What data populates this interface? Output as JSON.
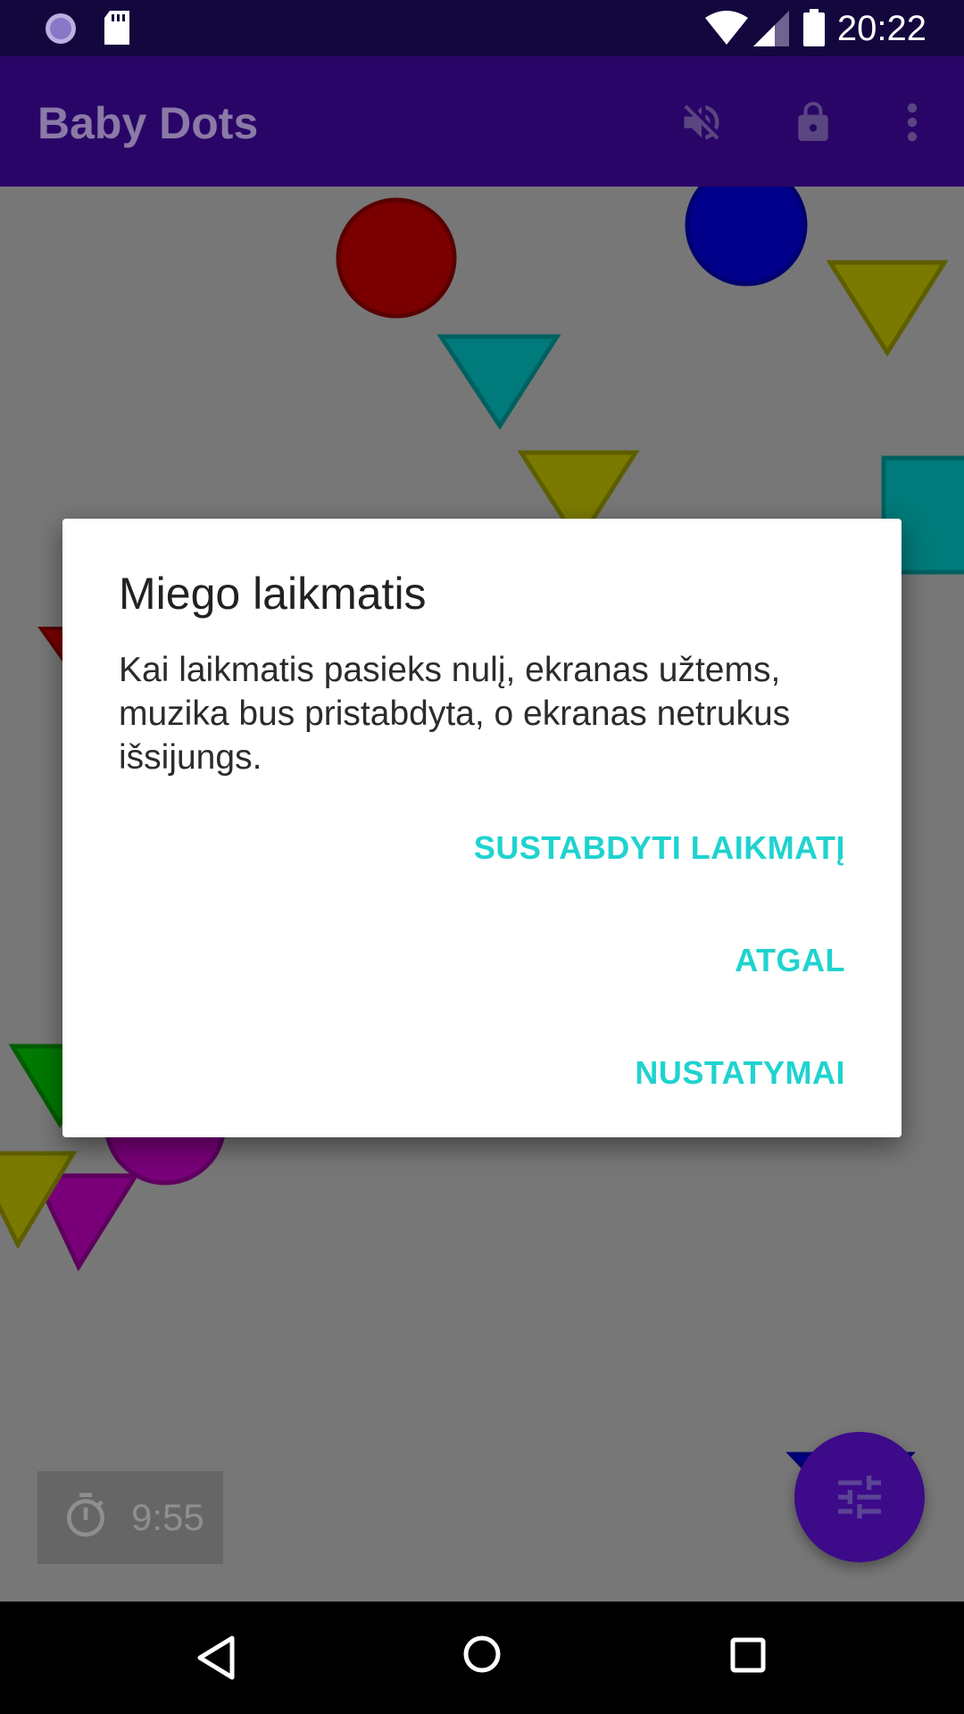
{
  "status_bar": {
    "time": "20:22",
    "icons": [
      "loading-circle-icon",
      "sd-card-icon",
      "wifi-icon",
      "signal-icon",
      "battery-icon"
    ]
  },
  "app_bar": {
    "title": "Baby Dots",
    "actions": [
      "volume-off-icon",
      "lock-icon",
      "more-vert-icon"
    ]
  },
  "timer": {
    "icon": "stopwatch-icon",
    "value": "9:55"
  },
  "fab": {
    "icon": "tune-sliders-icon"
  },
  "dialog": {
    "title": "Miego laikmatis",
    "message": "Kai laikmatis pasieks nulį, ekranas užtems, muzika bus pristabdyta, o ekranas netrukus išsijungs.",
    "buttons": {
      "stop_timer": "SUSTABDYTI LAIKMATĮ",
      "back": "ATGAL",
      "settings": "NUSTATYMAI"
    },
    "button_color": "#1fd3cf"
  },
  "navigation_bar": {
    "icons": [
      "back-triangle-icon",
      "home-circle-icon",
      "recents-square-icon"
    ]
  },
  "colors": {
    "app_bar": "#2a0568",
    "status_bar": "#13073e",
    "canvas_background": "#777777",
    "fab": "#3d0a8a"
  }
}
